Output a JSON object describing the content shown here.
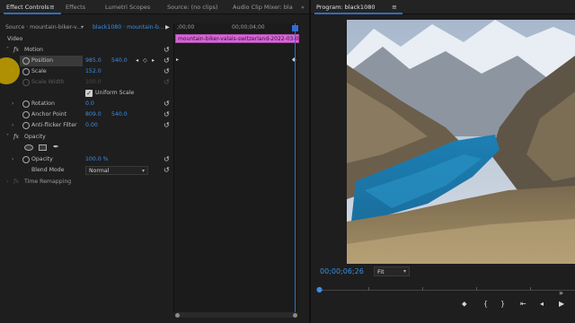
{
  "tabs": {
    "effect_controls": "Effect Controls",
    "menu_icon": "≡",
    "effects": "Effects",
    "lumetri": "Lumetri Scopes",
    "source": "Source: (no clips)",
    "audio_mixer": "Audio Clip Mixer: bla"
  },
  "source_bar": {
    "source": "Source · mountain-biker-v...",
    "sequence": "black1080 · mountain-b...",
    "play_icon": "▶"
  },
  "timeline_ruler": {
    "start": ";00;00",
    "mid": "00;00;04;00"
  },
  "clip": {
    "name": "mountain-biker-valais-switzerland-2022-03-07"
  },
  "sections": {
    "video": "Video",
    "motion": "Motion",
    "opacity": "Opacity",
    "time_remapping": "Time Remapping"
  },
  "properties": {
    "position": {
      "label": "Position",
      "x": "985.0",
      "y": "540.0"
    },
    "scale": {
      "label": "Scale",
      "value": "152.0"
    },
    "scale_width": {
      "label": "Scale Width",
      "value": "100.0"
    },
    "uniform_scale": {
      "label": "Uniform Scale",
      "checked": true
    },
    "rotation": {
      "label": "Rotation",
      "value": "0.0"
    },
    "anchor_point": {
      "label": "Anchor Point",
      "x": "809.0",
      "y": "540.0"
    },
    "anti_flicker": {
      "label": "Anti-flicker Filter",
      "value": "0.00"
    },
    "opacity": {
      "label": "Opacity",
      "value": "100.0 %"
    },
    "blend_mode": {
      "label": "Blend Mode",
      "value": "Normal"
    }
  },
  "program": {
    "title": "Program: black1080",
    "menu_icon": "≡",
    "timecode": "00;00;06;26",
    "fit": "Fit"
  },
  "colors": {
    "accent_blue": "#3a8ee6",
    "clip_pink": "#d667d6",
    "panel_bg": "#1e1e1e"
  }
}
